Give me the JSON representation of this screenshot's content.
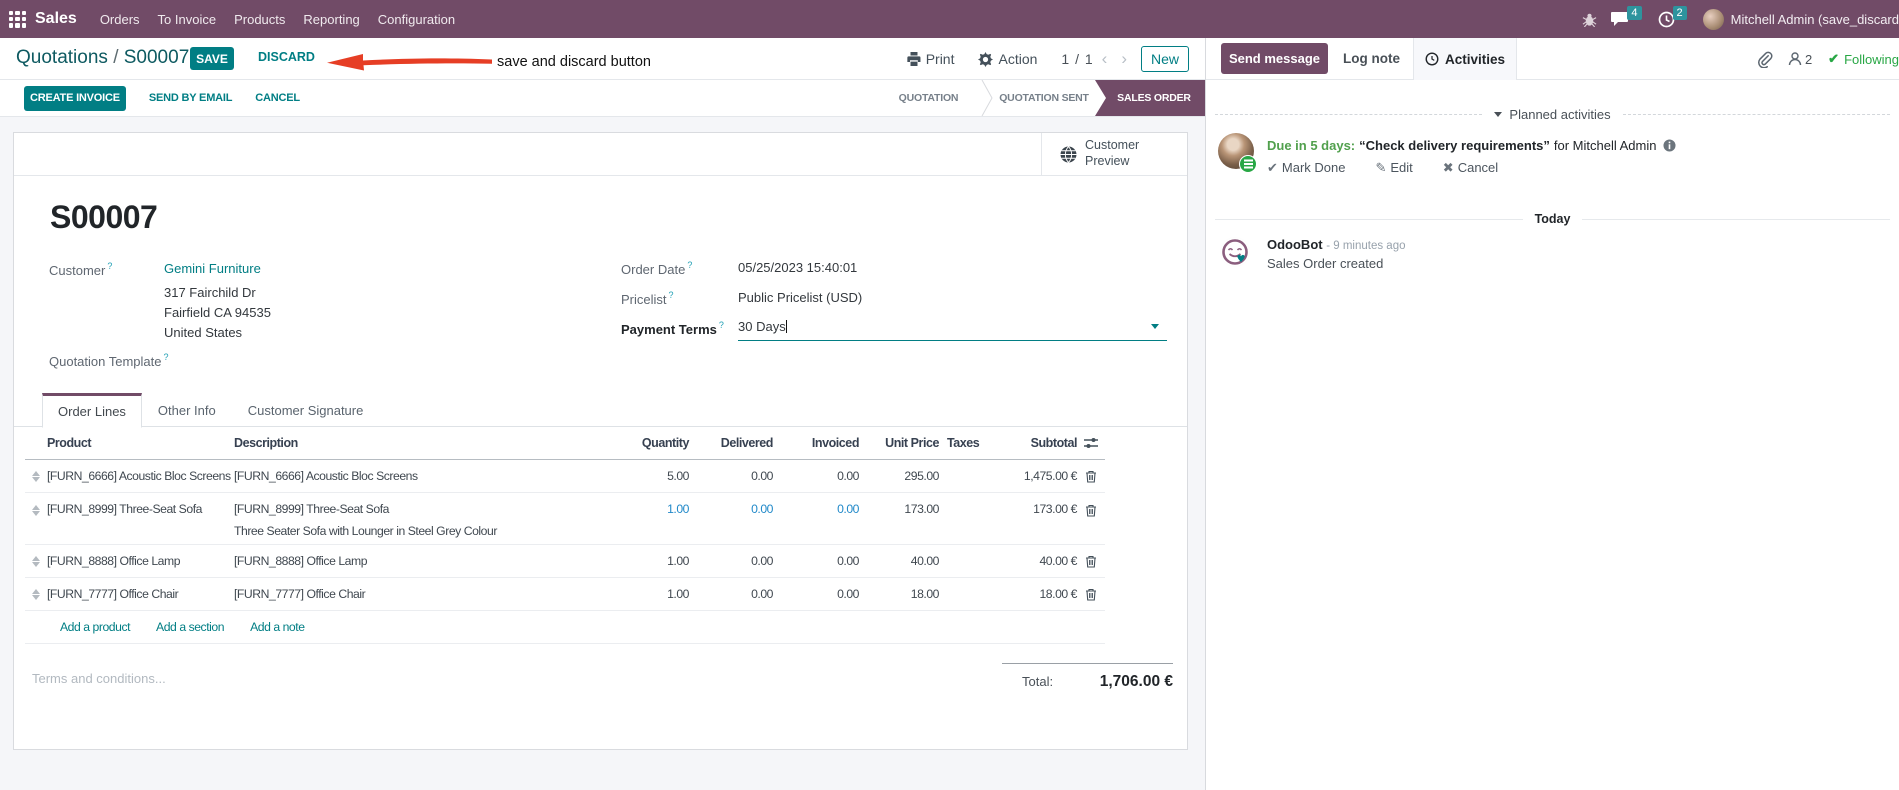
{
  "nav": {
    "app_name": "Sales",
    "items": [
      "Orders",
      "To Invoice",
      "Products",
      "Reporting",
      "Configuration"
    ],
    "messages_badge": "4",
    "activities_badge": "2",
    "user_name": "Mitchell Admin (save_discard"
  },
  "breadcrumb": {
    "parent": "Quotations",
    "separator": "/",
    "current": "S00007",
    "save_label": "SAVE",
    "discard_label": "DISCARD"
  },
  "annotation": {
    "text": "save and discard button"
  },
  "controls": {
    "print_label": "Print",
    "action_label": "Action",
    "pager": "1 / 1",
    "new_label": "New"
  },
  "status_buttons": {
    "create_invoice": "CREATE INVOICE",
    "send_by_email": "SEND BY EMAIL",
    "cancel": "CANCEL"
  },
  "stages": {
    "quotation": "QUOTATION",
    "quotation_sent": "QUOTATION SENT",
    "sales_order": "SALES ORDER"
  },
  "sheet": {
    "preview_button": "Customer Preview",
    "title": "S00007",
    "help_marker": "?",
    "fields": {
      "customer_label": "Customer",
      "customer_value": "Gemini Furniture",
      "address_line1": "317 Fairchild Dr",
      "address_line2": "Fairfield CA 94535",
      "address_line3": "United States",
      "quotation_template_label": "Quotation Template",
      "order_date_label": "Order Date",
      "order_date_value": "05/25/2023 15:40:01",
      "pricelist_label": "Pricelist",
      "pricelist_value": "Public Pricelist (USD)",
      "payment_terms_label": "Payment Terms",
      "payment_terms_value": "30 Days"
    },
    "tabs": {
      "order_lines": "Order Lines",
      "other_info": "Other Info",
      "customer_signature": "Customer Signature"
    },
    "table": {
      "headers": {
        "product": "Product",
        "description": "Description",
        "quantity": "Quantity",
        "delivered": "Delivered",
        "invoiced": "Invoiced",
        "unit_price": "Unit Price",
        "taxes": "Taxes",
        "subtotal": "Subtotal"
      },
      "rows": [
        {
          "product": "[FURN_6666] Acoustic Bloc Screens",
          "description": "[FURN_6666] Acoustic Bloc Screens",
          "description2": "",
          "quantity": "5.00",
          "delivered": "0.00",
          "invoiced": "0.00",
          "unit_price": "295.00",
          "subtotal": "1,475.00 €",
          "modified": false
        },
        {
          "product": "[FURN_8999] Three-Seat Sofa",
          "description": "[FURN_8999] Three-Seat Sofa",
          "description2": "Three Seater Sofa with Lounger in Steel Grey Colour",
          "quantity": "1.00",
          "delivered": "0.00",
          "invoiced": "0.00",
          "unit_price": "173.00",
          "subtotal": "173.00 €",
          "modified": true
        },
        {
          "product": "[FURN_8888] Office Lamp",
          "description": "[FURN_8888] Office Lamp",
          "description2": "",
          "quantity": "1.00",
          "delivered": "0.00",
          "invoiced": "0.00",
          "unit_price": "40.00",
          "subtotal": "40.00 €",
          "modified": false
        },
        {
          "product": "[FURN_7777] Office Chair",
          "description": "[FURN_7777] Office Chair",
          "description2": "",
          "quantity": "1.00",
          "delivered": "0.00",
          "invoiced": "0.00",
          "unit_price": "18.00",
          "subtotal": "18.00 €",
          "modified": false
        }
      ],
      "add_links": {
        "product": "Add a product",
        "section": "Add a section",
        "note": "Add a note"
      }
    },
    "terms_placeholder": "Terms and conditions...",
    "total_label": "Total:",
    "total_value": "1,706.00 €"
  },
  "chatter": {
    "send_message": "Send message",
    "log_note": "Log note",
    "activities": "Activities",
    "followers_count": "2",
    "following": "Following",
    "planned_header": "Planned activities",
    "activity": {
      "due": "Due in 5 days:",
      "title": "“Check delivery requirements”",
      "for_text": "for Mitchell Admin",
      "mark_done": "Mark Done",
      "edit": "Edit",
      "cancel": "Cancel"
    },
    "today": "Today",
    "message": {
      "author": "OdooBot",
      "time": "- 9 minutes ago",
      "body": "Sales Order created"
    }
  }
}
